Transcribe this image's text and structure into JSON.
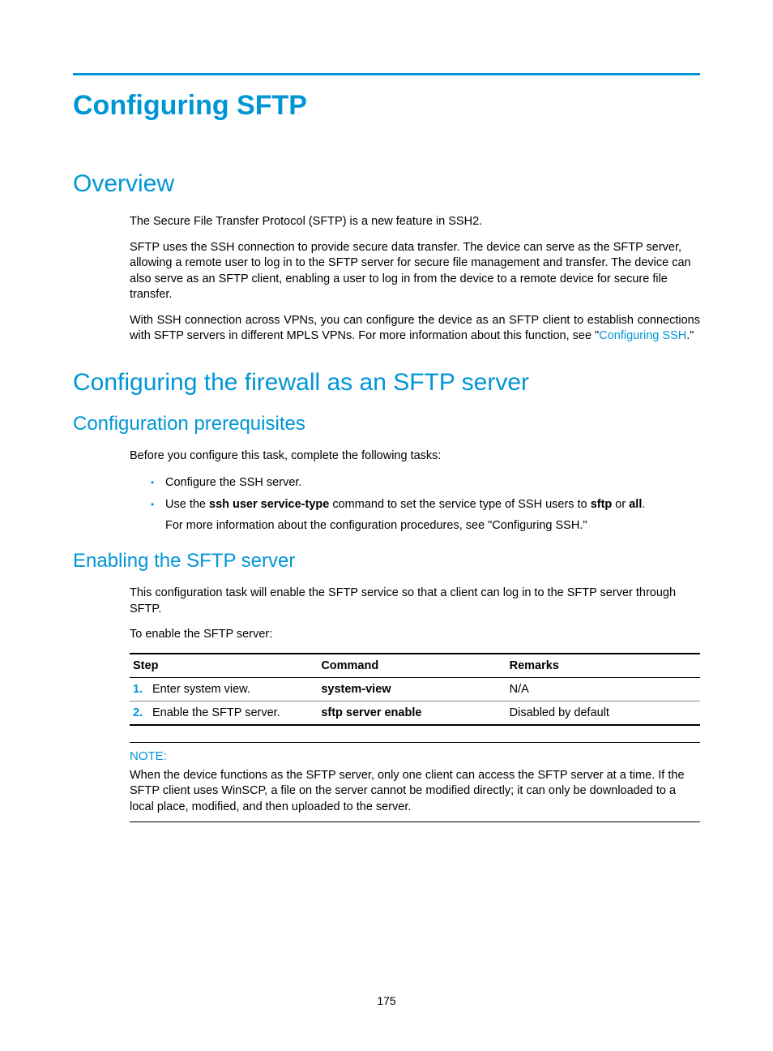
{
  "title": "Configuring SFTP",
  "sections": {
    "overview": {
      "heading": "Overview",
      "p1": "The Secure File Transfer Protocol (SFTP) is a new feature in SSH2.",
      "p2": "SFTP uses the SSH connection to provide secure data transfer. The device can serve as the SFTP server, allowing a remote user to log in to the SFTP server for secure file management and transfer. The device can also serve as an SFTP client, enabling a user to log in from the device to a remote device for secure file transfer.",
      "p3_a": "With SSH connection across VPNs, you can configure the device as an SFTP client to establish connections with SFTP servers in different MPLS VPNs. For more information about this function, see \"",
      "p3_link": "Configuring SSH",
      "p3_b": ".\""
    },
    "firewall": {
      "heading": "Configuring the firewall as an SFTP server",
      "prereq": {
        "heading": "Configuration prerequisites",
        "intro": "Before you configure this task, complete the following tasks:",
        "b1": "Configure the SSH server.",
        "b2_a": "Use the ",
        "b2_cmd": "ssh user service-type",
        "b2_b": " command to set the service type of SSH users to ",
        "b2_sftp": "sftp",
        "b2_or": " or ",
        "b2_all": "all",
        "b2_c": ".",
        "b2_sub": "For more information about the configuration procedures, see \"Configuring SSH.\""
      },
      "enable": {
        "heading": "Enabling the SFTP server",
        "p1": "This configuration task will enable the SFTP service so that a client can log in to the SFTP server through SFTP.",
        "p2": "To enable the SFTP server:",
        "table": {
          "headers": {
            "step": "Step",
            "command": "Command",
            "remarks": "Remarks"
          },
          "rows": [
            {
              "num": "1.",
              "step": "Enter system view.",
              "command": "system-view",
              "remarks": "N/A"
            },
            {
              "num": "2.",
              "step": "Enable the SFTP server.",
              "command": "sftp server enable",
              "remarks": "Disabled by default"
            }
          ]
        },
        "note": {
          "label": "NOTE:",
          "text": "When the device functions as the SFTP server, only one client can access the SFTP server at a time. If the SFTP client uses WinSCP, a file on the server cannot be modified directly; it can only be downloaded to a local place, modified, and then uploaded to the server."
        }
      }
    }
  },
  "page_number": "175"
}
